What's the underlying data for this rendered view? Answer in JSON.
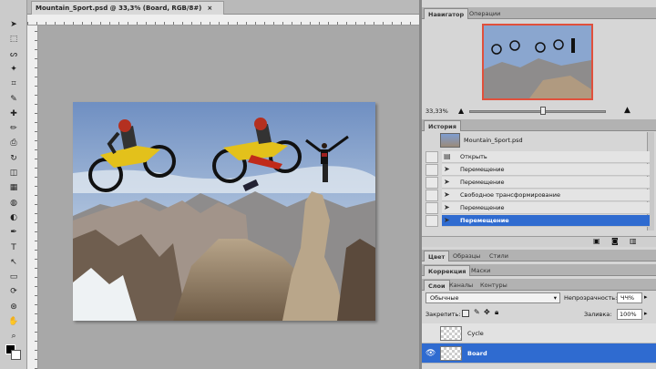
{
  "document": {
    "tab_title": "Mountain_Sport.psd @ 33,3% (Board, RGB/8#)",
    "tab_close": "×"
  },
  "toolbar": {
    "tools": [
      "move-icon",
      "marquee-icon",
      "lasso-icon",
      "magic-wand-icon",
      "crop-icon",
      "eyedropper-icon",
      "healing-brush-icon",
      "brush-icon",
      "clone-stamp-icon",
      "history-brush-icon",
      "eraser-icon",
      "gradient-icon",
      "blur-icon",
      "dodge-icon",
      "pen-icon",
      "type-icon",
      "path-select-icon",
      "shape-icon",
      "3d-rotate-icon",
      "3d-orbit-icon",
      "hand-icon",
      "zoom-icon"
    ],
    "glyphs": [
      "➤",
      "⬚",
      "ᔕ",
      "✦",
      "⌗",
      "✎",
      "✚",
      "✏",
      "⎙",
      "↻",
      "◫",
      "▦",
      "◍",
      "◐",
      "✒",
      "T",
      "↖",
      "▭",
      "⟳",
      "⊛",
      "✋",
      "⌕"
    ]
  },
  "navigator": {
    "tabs": [
      "Навигатор",
      "Операции"
    ],
    "zoom": "33,33%"
  },
  "history": {
    "tab": "История",
    "snapshot": "Mountain_Sport.psd",
    "items": [
      "Открыть",
      "Перемещение",
      "Перемещение",
      "Свободное трансформирование",
      "Перемещение",
      "Перемещение"
    ],
    "selected_index": 5
  },
  "color_tabs": [
    "Цвет",
    "Образцы",
    "Стили"
  ],
  "adj_tabs": [
    "Коррекция",
    "Маски"
  ],
  "layers": {
    "tabs": [
      "Слои",
      "Каналы",
      "Контуры"
    ],
    "blend_mode": "Обычные",
    "opacity_label": "Непрозрачность:",
    "opacity": "ЧЧ%",
    "lock_label": "Закрепить:",
    "fill_label": "Заливка:",
    "fill": "100%",
    "items": [
      {
        "name": "Cycle",
        "visible": false,
        "selected": false
      },
      {
        "name": "Board",
        "visible": true,
        "selected": true
      }
    ]
  },
  "colors": {
    "selection": "#2f6bd0",
    "navigator_frame": "#e0503c"
  }
}
